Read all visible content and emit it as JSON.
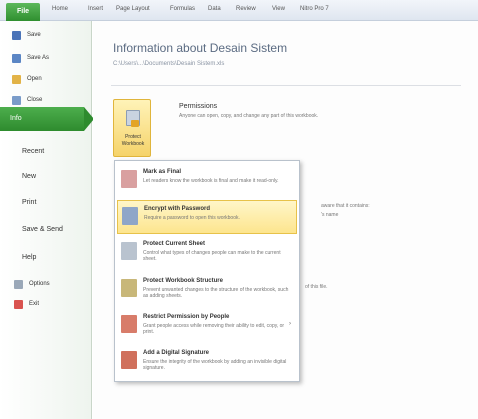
{
  "ribbon": {
    "file_tab": "File",
    "tabs": [
      "Home",
      "Insert",
      "Page Layout",
      "Formulas",
      "Data",
      "Review",
      "View",
      "Nitro Pro 7"
    ]
  },
  "sidebar": {
    "quick_commands": [
      {
        "label": "Save",
        "icon": "save-icon"
      },
      {
        "label": "Save As",
        "icon": "save-as-icon"
      },
      {
        "label": "Open",
        "icon": "open-folder-icon"
      },
      {
        "label": "Close",
        "icon": "close-file-icon"
      }
    ],
    "active_tab": "Info",
    "nav": [
      "Recent",
      "New",
      "Print",
      "Save & Send",
      "Help"
    ],
    "bottom_commands": [
      {
        "label": "Options",
        "icon": "options-icon"
      },
      {
        "label": "Exit",
        "icon": "exit-icon"
      }
    ]
  },
  "main": {
    "title": "Information about Desain Sistem",
    "path": "C:\\Users\\...\\Documents\\Desain Sistem.xls",
    "protect_button": {
      "line1": "Protect",
      "line2": "Workbook"
    },
    "permissions": {
      "title": "Permissions",
      "desc": "Anyone can open, copy, and change any part of this workbook."
    },
    "partial_texts": [
      "aware that it contains:",
      "'s name",
      "of this file."
    ]
  },
  "dropdown": {
    "items": [
      {
        "title": "Mark as Final",
        "desc": "Let readers know the workbook is final and make it read-only.",
        "icon": "mark-final-icon",
        "highlighted": false,
        "arrow": ""
      },
      {
        "title": "Encrypt with Password",
        "desc": "Require a password to open this workbook.",
        "icon": "encrypt-lock-icon",
        "highlighted": true,
        "arrow": ""
      },
      {
        "title": "Protect Current Sheet",
        "desc": "Control what types of changes people can make to the current sheet.",
        "icon": "protect-sheet-icon",
        "highlighted": false,
        "arrow": ""
      },
      {
        "title": "Protect Workbook Structure",
        "desc": "Prevent unwanted changes to the structure of the workbook, such as adding sheets.",
        "icon": "protect-structure-icon",
        "highlighted": false,
        "arrow": ""
      },
      {
        "title": "Restrict Permission by People",
        "desc": "Grant people access while removing their ability to edit, copy, or print.",
        "icon": "restrict-permission-icon",
        "highlighted": false,
        "arrow": "›"
      },
      {
        "title": "Add a Digital Signature",
        "desc": "Ensure the integrity of the workbook by adding an invisible digital signature.",
        "icon": "digital-signature-icon",
        "highlighted": false,
        "arrow": ""
      }
    ]
  },
  "colors": {
    "file_tab": "#3a9a3a",
    "active_tab": "#3a9e3a",
    "highlight": "#fde58e",
    "title": "#5b6b82"
  }
}
